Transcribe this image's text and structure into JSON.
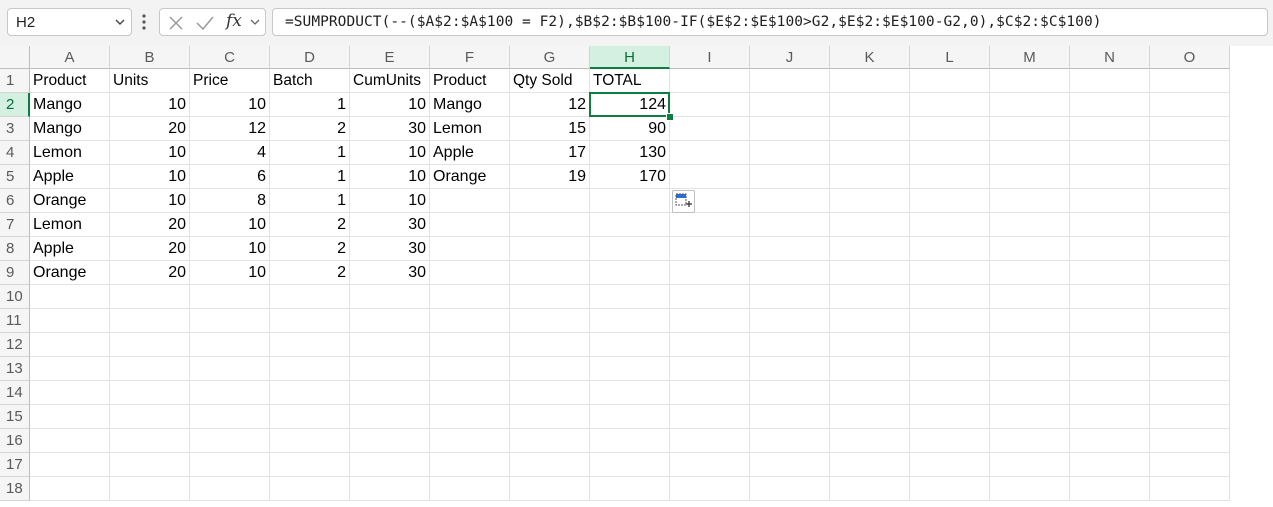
{
  "name_box": {
    "value": "H2"
  },
  "formula_bar": {
    "formula": "=SUMPRODUCT(--($A$2:$A$100 = F2),$B$2:$B$100-IF($E$2:$E$100>G2,$E$2:$E$100-G2,0),$C$2:$C$100)",
    "fx_label": "fx"
  },
  "columns": [
    "A",
    "B",
    "C",
    "D",
    "E",
    "F",
    "G",
    "H",
    "I",
    "J",
    "K",
    "L",
    "M",
    "N",
    "O"
  ],
  "rows": [
    "1",
    "2",
    "3",
    "4",
    "5",
    "6",
    "7",
    "8",
    "9",
    "10",
    "11",
    "12",
    "13",
    "14",
    "15",
    "16",
    "17",
    "18"
  ],
  "selected_cell": "H2",
  "cells": {
    "header": [
      "Product",
      "Units",
      "Price",
      "Batch",
      "CumUnits",
      "Product",
      "Qty Sold",
      "TOTAL"
    ],
    "data": [
      [
        "Mango",
        "10",
        "10",
        "1",
        "10",
        "Mango",
        "12",
        "124"
      ],
      [
        "Mango",
        "20",
        "12",
        "2",
        "30",
        "Lemon",
        "15",
        "90"
      ],
      [
        "Lemon",
        "10",
        "4",
        "1",
        "10",
        "Apple",
        "17",
        "130"
      ],
      [
        "Apple",
        "10",
        "6",
        "1",
        "10",
        "Orange",
        "19",
        "170"
      ],
      [
        "Orange",
        "10",
        "8",
        "1",
        "10",
        "",
        "",
        ""
      ],
      [
        "Lemon",
        "20",
        "10",
        "2",
        "30",
        "",
        "",
        ""
      ],
      [
        "Apple",
        "20",
        "10",
        "2",
        "30",
        "",
        "",
        ""
      ],
      [
        "Orange",
        "20",
        "10",
        "2",
        "30",
        "",
        "",
        ""
      ]
    ]
  },
  "accent_color": "#107c41"
}
